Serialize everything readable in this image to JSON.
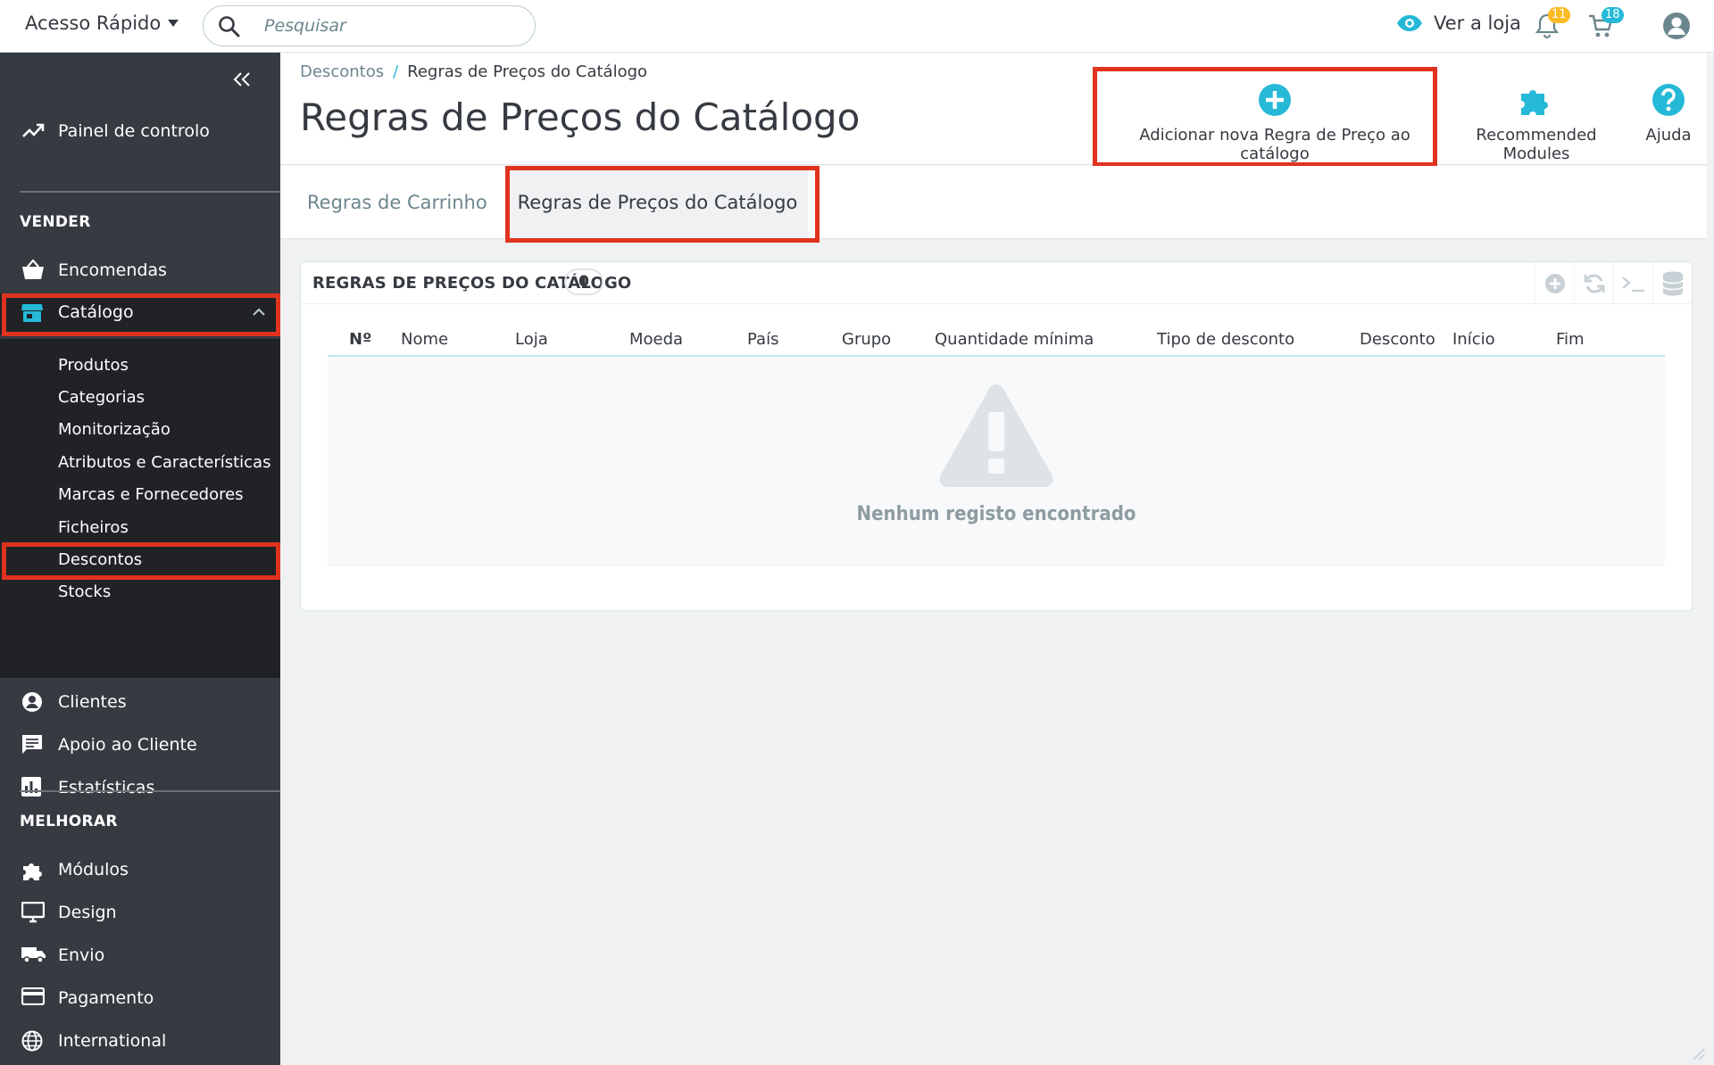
{
  "topbar": {
    "quick_access": "Acesso Rápido",
    "search_placeholder": "Pesquisar",
    "view_shop": "Ver a loja",
    "notifications_count": "11",
    "orders_count": "18"
  },
  "sidebar": {
    "dashboard": "Painel de controlo",
    "section_sell": "VENDER",
    "orders": "Encomendas",
    "catalog": "Catálogo",
    "catalog_sub": [
      "Produtos",
      "Categorias",
      "Monitorização",
      "Atributos e Características",
      "Marcas e Fornecedores",
      "Ficheiros",
      "Descontos",
      "Stocks"
    ],
    "customers": "Clientes",
    "customer_service": "Apoio ao Cliente",
    "stats": "Estatísticas",
    "section_improve": "MELHORAR",
    "modules": "Módulos",
    "design": "Design",
    "shipping": "Envio",
    "payment": "Pagamento",
    "international": "International"
  },
  "header": {
    "breadcrumb_parent": "Descontos",
    "breadcrumb_current": "Regras de Preços do Catálogo",
    "title": "Regras de Preços do Catálogo",
    "add_button": "Adicionar nova Regra de Preço ao catálogo",
    "recommended": "Recommended Modules",
    "help": "Ajuda"
  },
  "tabs": [
    {
      "label": "Regras de Carrinho"
    },
    {
      "label": "Regras de Preços do Catálogo"
    }
  ],
  "panel": {
    "title": "REGRAS DE PREÇOS DO CATÁLOGO",
    "count": "0",
    "columns": [
      "Nº",
      "Nome",
      "Loja",
      "Moeda",
      "País",
      "Grupo",
      "Quantidade mínima",
      "Tipo de desconto",
      "Desconto",
      "Início",
      "Fim"
    ],
    "empty_message": "Nenhum registo encontrado"
  },
  "colors": {
    "accent": "#25b9d7",
    "sidebar": "#363a41",
    "highlight_box": "#e0331f",
    "badge_orange": "#fbbb22"
  }
}
